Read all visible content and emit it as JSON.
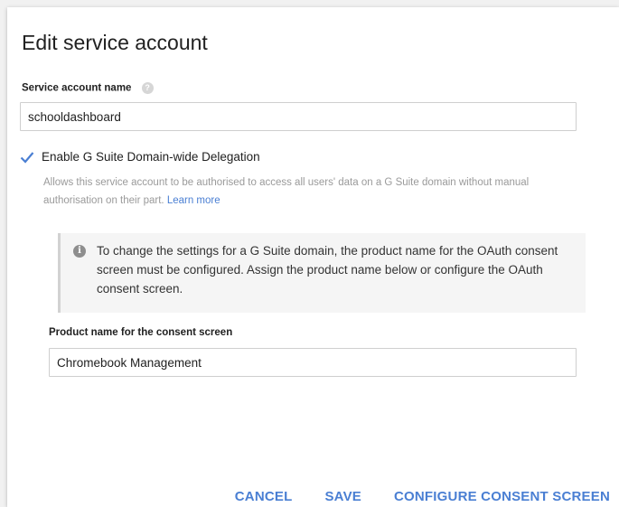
{
  "dialog": {
    "title": "Edit service account"
  },
  "service_account": {
    "label": "Service account name",
    "help_icon": "help-circle-icon",
    "value": "schooldashboard"
  },
  "delegation": {
    "checked": true,
    "check_icon": "checkmark-icon",
    "label": "Enable G Suite Domain-wide Delegation",
    "description": "Allows this service account to be authorised to access all users' data on a G Suite domain without manual authorisation on their part.",
    "learn_more": "Learn more"
  },
  "info": {
    "icon": "info-icon",
    "text": "To change the settings for a G Suite domain, the product name for the OAuth consent screen must be configured. Assign the product name below or configure the OAuth consent screen."
  },
  "product_name": {
    "label": "Product name for the consent screen",
    "value": "Chromebook Management"
  },
  "actions": {
    "cancel": "CANCEL",
    "save": "SAVE",
    "configure": "CONFIGURE CONSENT SCREEN"
  },
  "colors": {
    "accent": "#4a7fd3",
    "muted_text": "#9a9a9a",
    "info_bg": "#f5f5f5"
  }
}
